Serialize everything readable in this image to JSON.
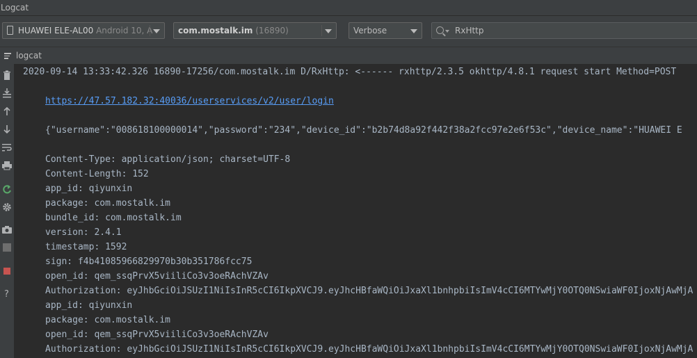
{
  "window": {
    "title": "Logcat"
  },
  "toolbar": {
    "device": {
      "name": "HUAWEI ELE-AL00",
      "detail": "Android 10, A"
    },
    "process": {
      "package": "com.mostalk.im",
      "pid": "(16890)"
    },
    "log_level": "Verbose",
    "search": {
      "value": "RxHttp",
      "icon": "search-icon"
    }
  },
  "panel": {
    "label": "logcat"
  },
  "sidebar": {
    "buttons": [
      "clear-logcat-icon",
      "scroll-to-end-icon",
      "up-arrow-icon",
      "down-arrow-icon",
      "soft-wraps-icon",
      "print-icon",
      "restart-icon",
      "settings-icon",
      "screen-capture-icon",
      "screen-record-icon",
      "stop-icon",
      "help-icon"
    ]
  },
  "log": {
    "header": "2020-09-14 13:33:42.326 16890-17256/com.mostalk.im D/RxHttp: <------ rxhttp/2.3.5 okhttp/4.8.1 request start Method=POST",
    "url": "https://47.57.182.32:40036/userservices/v2/user/login",
    "body": "{\"username\":\"008618100000014\",\"password\":\"234\",\"device_id\":\"b2b74d8a92f442f38a2fcc97e2e6f53c\",\"device_name\":\"HUAWEI E",
    "headers": [
      "Content-Type: application/json; charset=UTF-8",
      "Content-Length: 152",
      "app_id: qiyunxin",
      "package: com.mostalk.im",
      "bundle_id: com.mostalk.im",
      "version: 2.4.1",
      "timestamp: 1592",
      "sign: f4b41085966829970b30b351786fcc75",
      "open_id: qem_ssqPrvX5viiliCo3v3oeRAchVZAv",
      "Authorization: eyJhbGciOiJSUzI1NiIsInR5cCI6IkpXVCJ9.eyJhcHBfaWQiOiJxaXl1bnhpbiIsImV4cCI6MTYwMjY0OTQ0NSwiaWF0IjoxNjAwMjA",
      "app_id: qiyunxin",
      "package: com.mostalk.im",
      "open_id: qem_ssqPrvX5viiliCo3v3oeRAchVZAv",
      "Authorization: eyJhbGciOiJSUzI1NiIsInR5cCI6IkpXVCJ9.eyJhcHBfaWQiOiJxaXl1bnhpbiIsImV4cCI6MTYwMjY0OTQ0NSwiaWF0IjoxNjAwMjA"
    ]
  }
}
